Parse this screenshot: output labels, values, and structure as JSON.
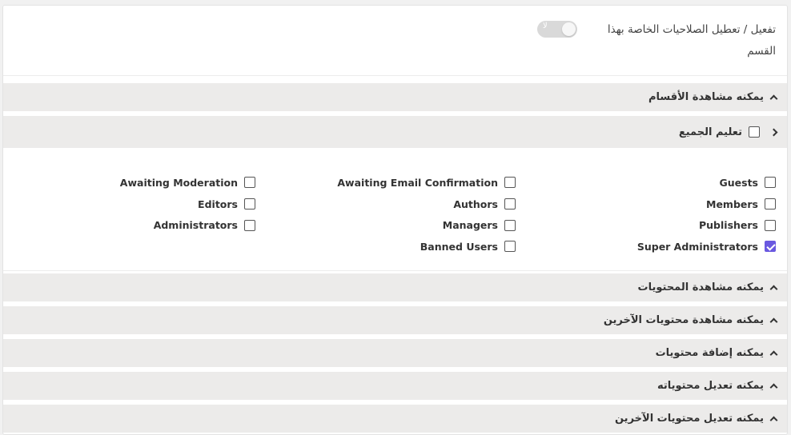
{
  "toggle": {
    "label": "تفعيل / تعطيل الصلاحيات الخاصة بهذا القسم",
    "state_mark": "لا",
    "enabled": false
  },
  "sections": [
    {
      "label": "يمكنه مشاهدة الأقسام",
      "expanded": true
    },
    {
      "label": "يمكنه مشاهدة المحتويات",
      "expanded": false
    },
    {
      "label": "يمكنه مشاهدة محتويات الآخرين",
      "expanded": false
    },
    {
      "label": "يمكنه إضافة محتويات",
      "expanded": false
    },
    {
      "label": "يمكنه تعديل محتوياته",
      "expanded": false
    },
    {
      "label": "يمكنه تعديل محتويات الآخرين",
      "expanded": false
    }
  ],
  "select_all": {
    "label": "تعليم الجميع",
    "checked": false
  },
  "groups": {
    "column_right": [
      {
        "label": "Guests",
        "checked": false
      },
      {
        "label": "Members",
        "checked": false
      },
      {
        "label": "Publishers",
        "checked": false
      },
      {
        "label": "Super Administrators",
        "checked": true
      }
    ],
    "column_middle": [
      {
        "label": "Awaiting Email Confirmation",
        "checked": false
      },
      {
        "label": "Authors",
        "checked": false
      },
      {
        "label": "Managers",
        "checked": false
      },
      {
        "label": "Banned Users",
        "checked": false
      }
    ],
    "column_left": [
      {
        "label": "Awaiting Moderation",
        "checked": false
      },
      {
        "label": "Editors",
        "checked": false
      },
      {
        "label": "Administrators",
        "checked": false
      }
    ]
  },
  "colors": {
    "accent": "#6a59e0",
    "section_bg": "#ecebea",
    "switch_off": "#d9d9d9"
  }
}
